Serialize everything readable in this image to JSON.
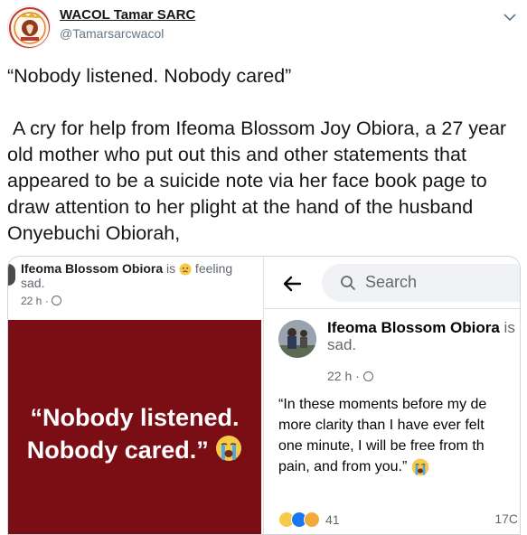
{
  "tweet": {
    "display_name": "WACOL Tamar SARC",
    "handle": "@Tamarsarcwacol",
    "text_line1": "“Nobody listened. Nobody cared”",
    "text_body": " A cry for help from Ifeoma Blossom Joy Obiora, a 27 year old mother who put out this and other statements that appeared to be a suicide note via her face book page to draw attention to her plight at the hand of the husband Onyebuchi Obiorah,"
  },
  "left_screenshot": {
    "name": "Ifeoma Blossom Obiora",
    "is_text": " is ",
    "feeling_text": " feeling",
    "feeling_value": "sad.",
    "timestamp": "22 h · ",
    "quote_line1": "“Nobody listened.",
    "quote_line2": "Nobody cared.”"
  },
  "right_screenshot": {
    "search_placeholder": "Search",
    "name": "Ifeoma Blossom Obiora",
    "name_suffix": " is",
    "feeling_value": "sad.",
    "timestamp": "22 h · ",
    "post_line1": "“In these moments before my de",
    "post_line2": "more clarity than I have ever felt",
    "post_line3": "one minute, I will be free from th",
    "post_line4": "pain, and from you.” ",
    "reaction_count": "41",
    "comment_count": "17C"
  },
  "icons": {
    "avatar_logo": "organization-logo",
    "chevron": "chevron-down-icon",
    "sad_emoji": "sad-face-emoji",
    "crying_emoji": "crying-face-emoji",
    "back": "back-arrow-icon",
    "search": "search-icon",
    "globe": "globe-icon"
  },
  "colors": {
    "poster_background": "#7a0e14",
    "link_blue": "#1b95e0",
    "facebook_like_blue": "#1877f2"
  }
}
